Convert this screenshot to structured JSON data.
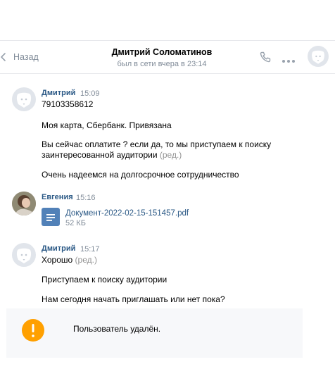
{
  "header": {
    "back_label": "Назад",
    "contact_name": "Дмитрий Соломатинов",
    "status": "был в сети вчера в 23:14",
    "icons": [
      "chevron-left-icon",
      "phone-icon",
      "more-icon",
      "dog-avatar-icon"
    ]
  },
  "messages": [
    {
      "author": "Дмитрий",
      "time": "15:09",
      "lines": [
        "79103358612",
        "Моя карта, Сбербанк. Привязана",
        "Вы сейчас оплатите ? если да, то мы приступаем к поиску",
        "заинтересованной аудитории",
        "Очень надеемся на долгосрочное сотрудничество"
      ],
      "edited_label": "(ред.)"
    },
    {
      "author": "Евгения",
      "time": "15:16",
      "attachment": {
        "name": "Документ-2022-02-15-151457.pdf",
        "size": "52 КБ"
      }
    },
    {
      "author": "Дмитрий",
      "time": "15:17",
      "lines": [
        "Хорошо",
        "Приступаем к поиску аудитории",
        "Нам сегодня начать приглашать или нет пока?"
      ],
      "edited_label": "(ред.)"
    }
  ],
  "banner": {
    "text": "Пользователь удалён.",
    "icon": "warning-icon",
    "color": "#ffa000"
  },
  "colors": {
    "link": "#2a5885",
    "muted": "#818c99",
    "accent": "#5181b8"
  }
}
